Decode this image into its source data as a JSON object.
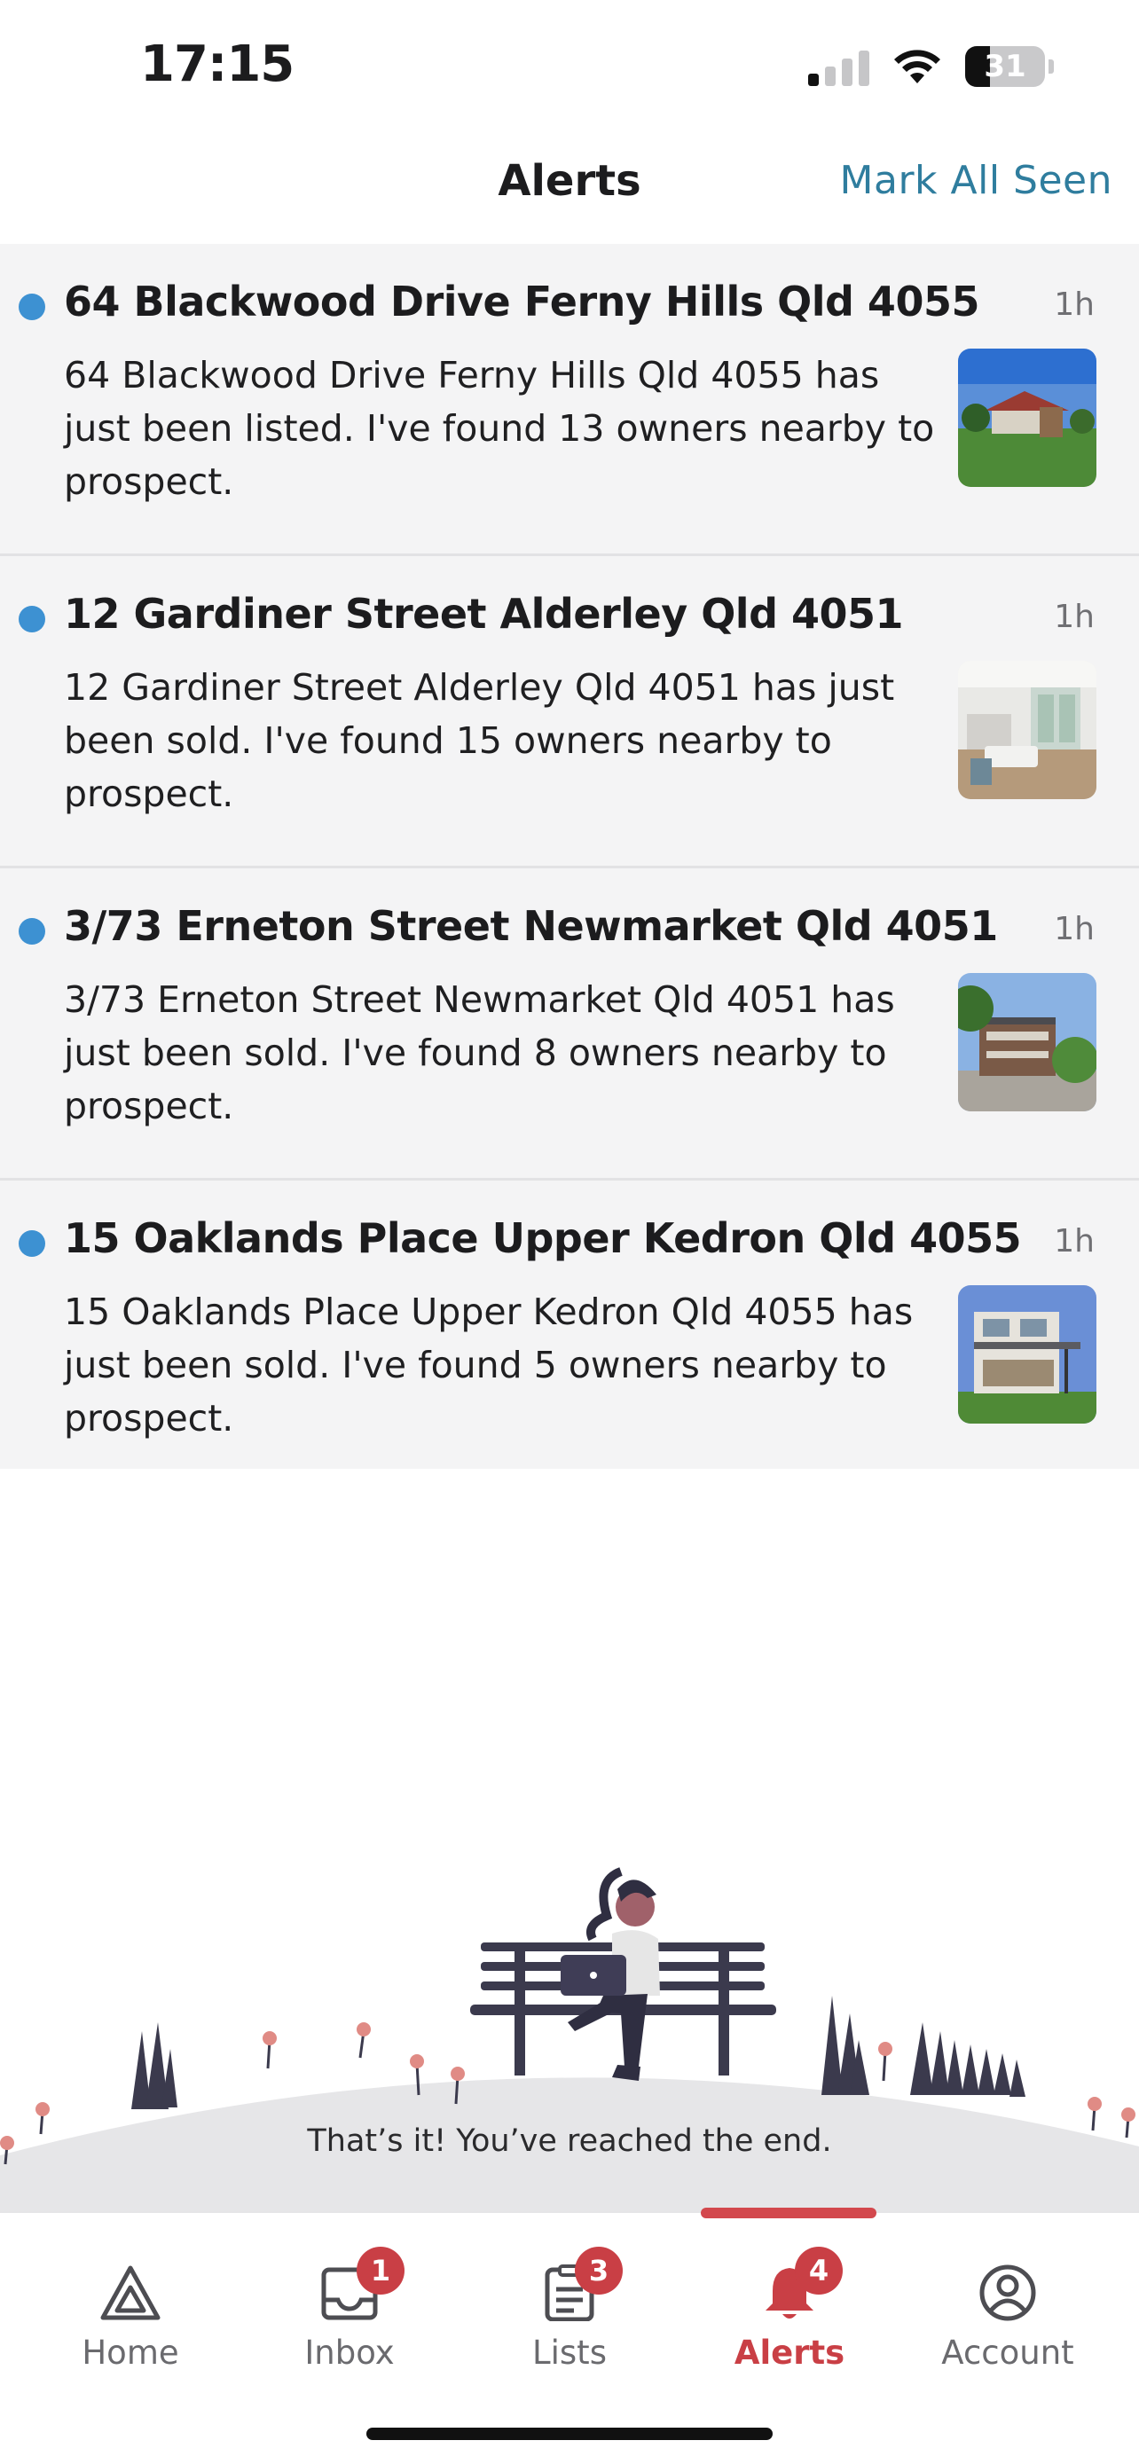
{
  "status_bar": {
    "time": "17:15",
    "battery_level": "31",
    "icons": [
      "signal-icon",
      "wifi-icon",
      "battery-icon"
    ]
  },
  "header": {
    "title": "Alerts",
    "mark_all_seen": "Mark All Seen"
  },
  "alerts": [
    {
      "title": "64 Blackwood Drive Ferny Hills Qld 4055",
      "time": "1h",
      "body": "64 Blackwood Drive Ferny Hills Qld 4055 has just been listed. I've found 13 owners nearby to prospect.",
      "unread": true
    },
    {
      "title": "12 Gardiner Street Alderley Qld 4051",
      "time": "1h",
      "body": "12 Gardiner Street Alderley Qld 4051 has just been sold. I've found 15 owners nearby to prospect.",
      "unread": true
    },
    {
      "title": "3/73 Erneton Street Newmarket Qld 4051",
      "time": "1h",
      "body": "3/73 Erneton Street Newmarket Qld 4051 has just been sold. I've found 8 owners nearby to prospect.",
      "unread": true
    },
    {
      "title": "15 Oaklands Place Upper Kedron Qld 4055",
      "time": "1h",
      "body": "15 Oaklands Place Upper Kedron Qld 4055 has just been sold. I've found 5 owners nearby to prospect.",
      "unread": true
    }
  ],
  "end_message": "That’s it! You’ve reached the end.",
  "tabbar": {
    "active": "Alerts",
    "tabs": [
      {
        "label": "Home",
        "icon": "home-icon",
        "badge": ""
      },
      {
        "label": "Inbox",
        "icon": "inbox-icon",
        "badge": "1"
      },
      {
        "label": "Lists",
        "icon": "lists-icon",
        "badge": "3"
      },
      {
        "label": "Alerts",
        "icon": "bell-icon",
        "badge": "4"
      },
      {
        "label": "Account",
        "icon": "account-icon",
        "badge": ""
      }
    ]
  },
  "colors": {
    "accent": "#c93f45",
    "link": "#2f7d9e",
    "unread_dot": "#3d91d2",
    "alert_bg": "#f4f4f5"
  }
}
